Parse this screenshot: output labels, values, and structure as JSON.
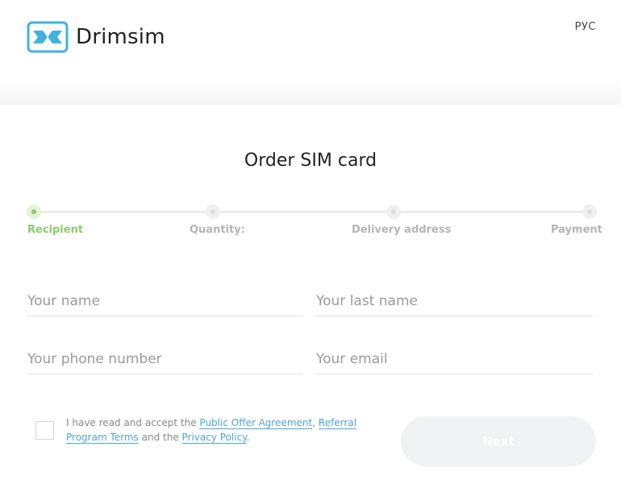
{
  "header": {
    "brand": "Drimsim",
    "language": "РУС"
  },
  "page": {
    "title": "Order SIM card"
  },
  "stepper": {
    "steps": [
      {
        "label": "Recipient",
        "active": true
      },
      {
        "label": "Quantity:",
        "active": false
      },
      {
        "label": "Delivery address",
        "active": false
      },
      {
        "label": "Payment",
        "active": false
      }
    ]
  },
  "form": {
    "first_name_placeholder": "Your name",
    "last_name_placeholder": "Your last name",
    "phone_placeholder": "Your phone number",
    "email_placeholder": "Your email",
    "first_name_value": "",
    "last_name_value": "",
    "phone_value": "",
    "email_value": ""
  },
  "consent": {
    "prefix": "I have read and accept the ",
    "offer_link": "Public Offer Agreement",
    "sep1": ", ",
    "referral_link": "Referral Program Terms",
    "sep2": " and the ",
    "privacy_link": "Privacy Policy",
    "suffix": "."
  },
  "actions": {
    "next_label": "Next"
  },
  "colors": {
    "brand_blue": "#3fb2e0",
    "active_green": "#8ccb6c",
    "link_blue": "#4fa3d9"
  }
}
